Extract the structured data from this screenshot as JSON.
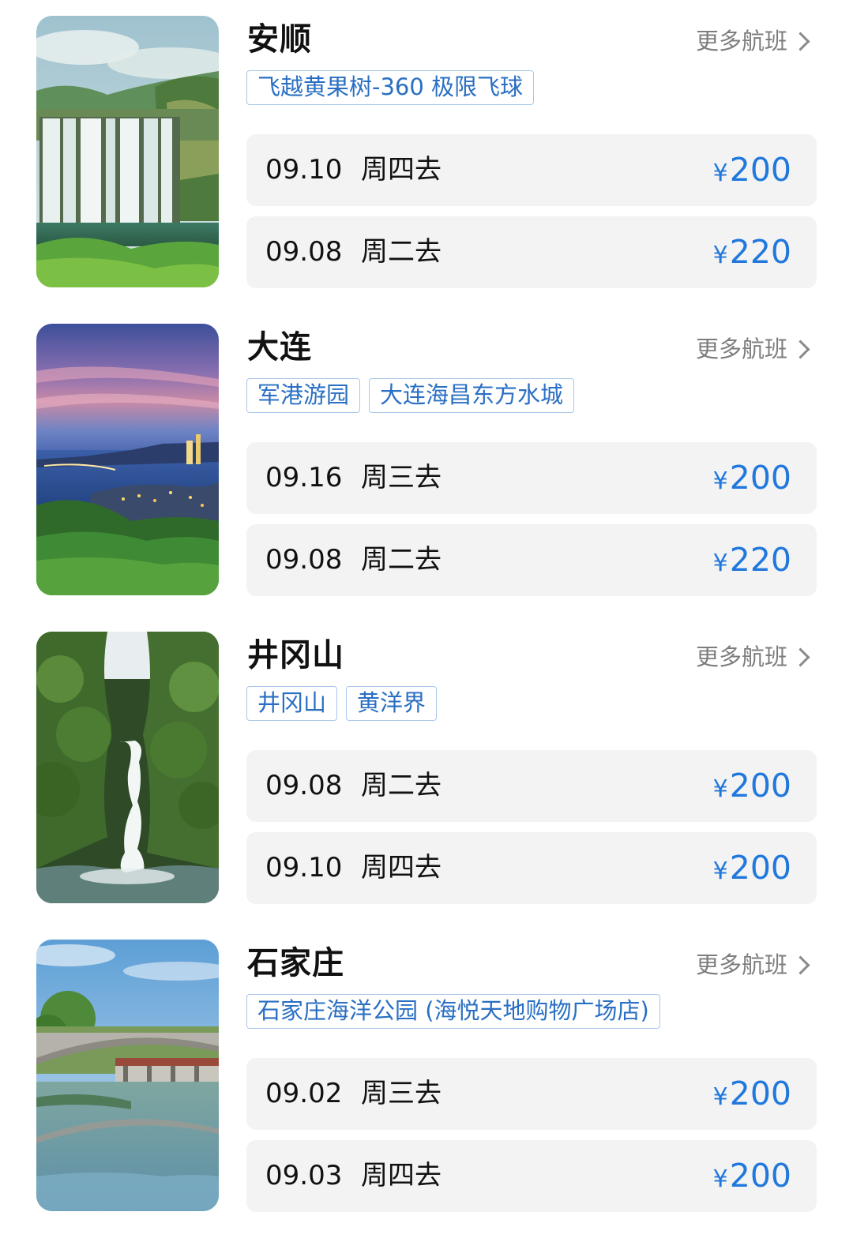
{
  "more_label": "更多航班",
  "colors": {
    "accent": "#2178dc",
    "tag_text": "#2a6fc3",
    "tag_border": "#aac7ea",
    "row_bg": "#f3f3f4",
    "secondary_text": "#7d7d7d"
  },
  "currency": "¥",
  "destinations": [
    {
      "city": "安顺",
      "image": "waterfall-photo",
      "tags": [
        "飞越黄果树-360 极限飞球"
      ],
      "flights": [
        {
          "date": "09.10",
          "day": "周四去",
          "price": "200"
        },
        {
          "date": "09.08",
          "day": "周二去",
          "price": "220"
        }
      ]
    },
    {
      "city": "大连",
      "image": "coastal-city-dusk-photo",
      "tags": [
        "军港游园",
        "大连海昌东方水城"
      ],
      "flights": [
        {
          "date": "09.16",
          "day": "周三去",
          "price": "200"
        },
        {
          "date": "09.08",
          "day": "周二去",
          "price": "220"
        }
      ]
    },
    {
      "city": "井冈山",
      "image": "forest-waterfall-photo",
      "tags": [
        "井冈山",
        "黄洋界"
      ],
      "flights": [
        {
          "date": "09.08",
          "day": "周二去",
          "price": "200"
        },
        {
          "date": "09.10",
          "day": "周四去",
          "price": "200"
        }
      ]
    },
    {
      "city": "石家庄",
      "image": "stone-arch-bridge-photo",
      "tags": [
        "石家庄海洋公园 (海悦天地购物广场店)"
      ],
      "flights": [
        {
          "date": "09.02",
          "day": "周三去",
          "price": "200"
        },
        {
          "date": "09.03",
          "day": "周四去",
          "price": "200"
        }
      ]
    }
  ]
}
